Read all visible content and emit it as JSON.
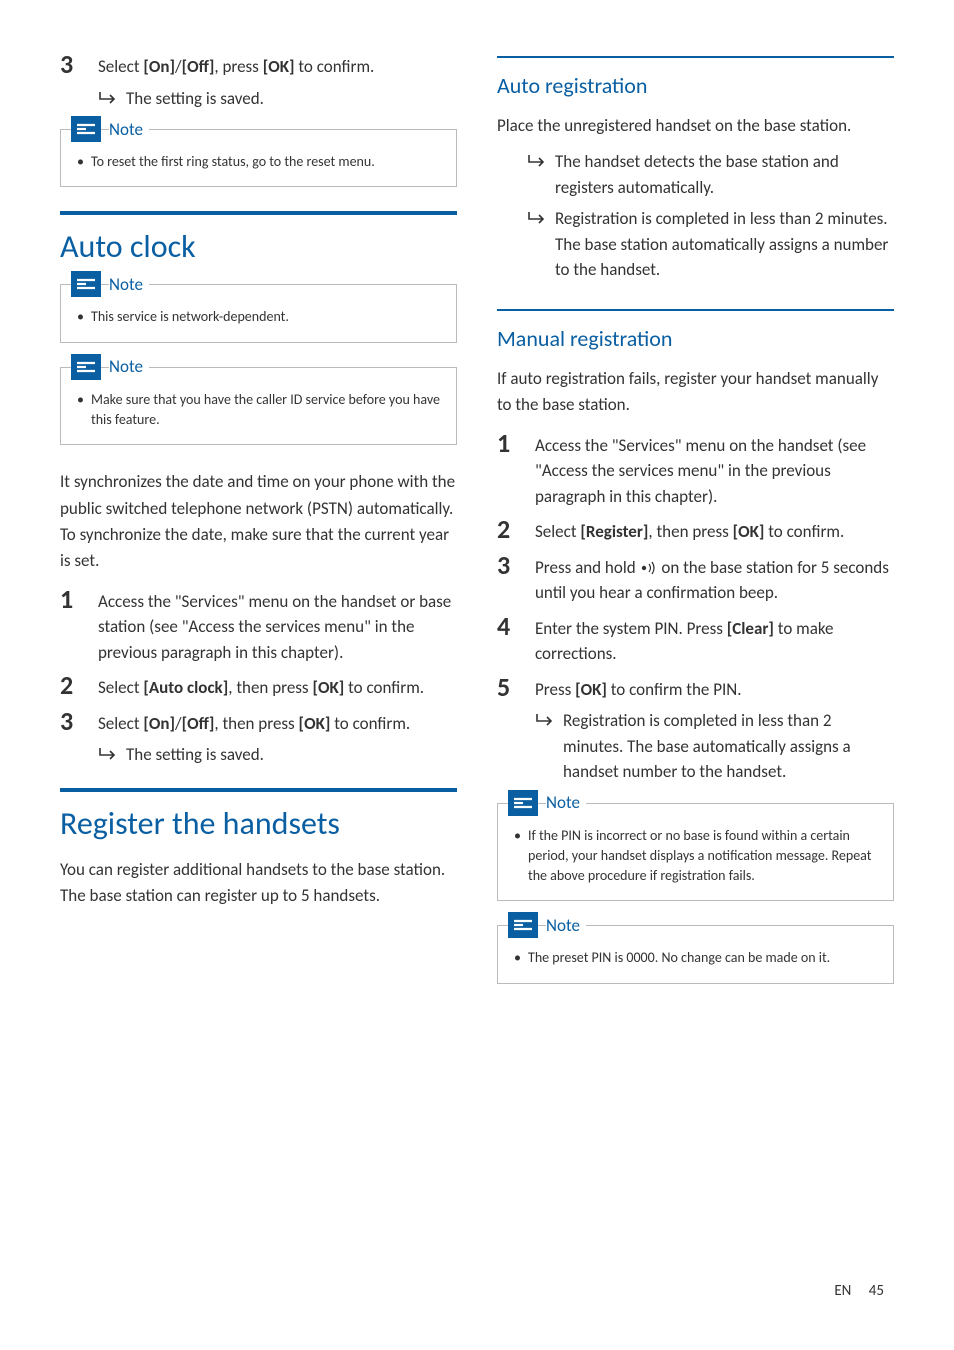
{
  "left": {
    "step3": {
      "num": "3",
      "pre": "Select ",
      "b1": "[On]",
      "mid": "/",
      "b2": "[Off]",
      "mid2": ", press ",
      "b3": "[OK]",
      "post": " to confirm."
    },
    "step3_result": "The setting is saved.",
    "note1_label": "Note",
    "note1_item": "To reset the first ring status, go to the reset menu.",
    "sec_autoclock": "Auto clock",
    "note2_label": "Note",
    "note2_item": "This service is network-dependent.",
    "note3_label": "Note",
    "note3_item": "Make sure that you have the caller ID service before you have this feature.",
    "autoclock_para": "It synchronizes the date and time on your phone with the public switched telephone network (PSTN) automatically. To synchronize the date, make sure that the current year is set.",
    "ac_s1": {
      "num": "1",
      "text": "Access the \"Services\" menu on the handset or base station (see \"Access the services menu\" in the previous paragraph in this chapter)."
    },
    "ac_s2": {
      "num": "2",
      "pre": "Select ",
      "b1": "[Auto clock]",
      "mid": ", then press ",
      "b2": "[OK]",
      "post": " to confirm."
    },
    "ac_s3": {
      "num": "3",
      "pre": "Select ",
      "b1": "[On]",
      "mid": "/",
      "b2": "[Off]",
      "mid2": ", then press ",
      "b3": "[OK]",
      "post": " to confirm."
    },
    "ac_s3_result": "The setting is saved.",
    "sec_register": "Register the handsets",
    "register_para": "You can register additional handsets to the base station. The base station can register up to 5 handsets."
  },
  "right": {
    "sub_autoreg": "Auto registration",
    "autoreg_para": "Place the unregistered handset on the base station.",
    "autoreg_r1": "The handset detects the base station and registers automatically.",
    "autoreg_r2": "Registration is completed in less than 2 minutes. The base station automatically assigns a number to the handset.",
    "sub_manreg": "Manual registration",
    "manreg_para": "If auto registration fails, register your handset manually to the base station.",
    "mr_s1": {
      "num": "1",
      "text": "Access the \"Services\" menu on the handset (see \"Access the services menu\" in the previous paragraph in this chapter)."
    },
    "mr_s2": {
      "num": "2",
      "pre": "Select ",
      "b1": "[Register]",
      "mid": ", then press ",
      "b2": "[OK]",
      "post": " to confirm."
    },
    "mr_s3": {
      "num": "3",
      "pre": "Press and hold ",
      "post": " on the base station for 5 seconds until you hear a confirmation beep."
    },
    "mr_s4": {
      "num": "4",
      "pre": "Enter the system PIN. Press ",
      "b1": "[Clear]",
      "post": " to make corrections."
    },
    "mr_s5": {
      "num": "5",
      "pre": "Press ",
      "b1": "[OK]",
      "post": " to confirm the PIN."
    },
    "mr_s5_result": "Registration is completed in less than 2 minutes. The base automatically assigns a handset number to the handset.",
    "note4_label": "Note",
    "note4_item": "If the PIN is incorrect or no base is found within a certain period, your handset displays a notification message. Repeat the above procedure if registration fails.",
    "note5_label": "Note",
    "note5_item": "The preset PIN is 0000. No change can be made on it."
  },
  "footer": {
    "lang": "EN",
    "page": "45"
  }
}
